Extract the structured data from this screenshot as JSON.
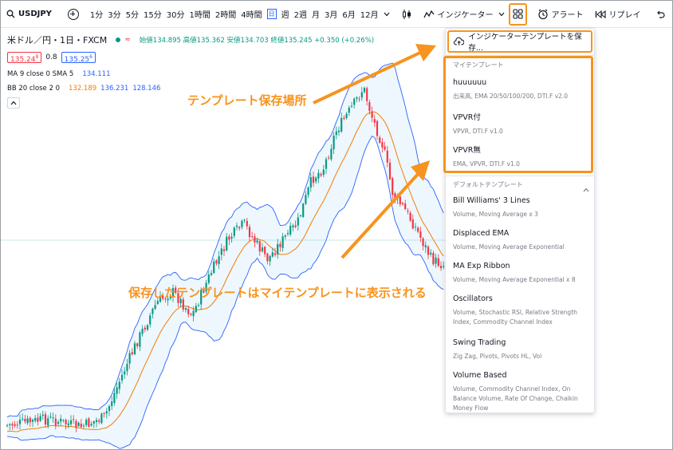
{
  "toolbar": {
    "symbol": "USDJPY",
    "timeframes": [
      "1分",
      "3分",
      "5分",
      "15分",
      "30分",
      "1時間",
      "2時間",
      "4時間",
      "日",
      "週",
      "2週",
      "月",
      "3月",
      "6月",
      "12月"
    ],
    "active_timeframe": "日",
    "indicators_label": "インジケーター",
    "alert_label": "アラート",
    "replay_label": "リプレイ"
  },
  "legend": {
    "title": "米ドル／円・1日・FXCM",
    "ohlc": "始値134.895 高値135.362 安値134.703 終値135.245 +0.350 (+0.26%)",
    "sell": "135.24",
    "sell_sup": "8",
    "spread": "0.8",
    "buy": "135.25",
    "buy_sup": "6",
    "ma_label": "MA 9 close 0 SMA 5",
    "ma_value": "134.111",
    "bb_label": "BB 20 close 2 0",
    "bb_basis": "132.189",
    "bb_upper": "136.231",
    "bb_lower": "128.146"
  },
  "panel": {
    "save_label": "インジケーターテンプレートを保存...",
    "my_section": "マイテンプレート",
    "default_section": "デフォルトテンプレート",
    "my_templates": [
      {
        "name": "huuuuuu",
        "desc": "出来高, EMA 20/50/100/200, DTI.F v2.0"
      },
      {
        "name": "VPVR付",
        "desc": "VPVR, DTI.F v1.0"
      },
      {
        "name": "VPVR無",
        "desc": "EMA, VPVR, DTI.F v1.0"
      }
    ],
    "default_templates": [
      {
        "name": "Bill Williams' 3 Lines",
        "desc": "Volume, Moving Average x 3"
      },
      {
        "name": "Displaced EMA",
        "desc": "Volume, Moving Average Exponential"
      },
      {
        "name": "MA Exp Ribbon",
        "desc": "Volume, Moving Average Exponential x 8"
      },
      {
        "name": "Oscillators",
        "desc": "Volume, Stochastic RSI, Relative Strength Index, Commodity Channel Index"
      },
      {
        "name": "Swing Trading",
        "desc": "Zig Zag, Pivots, Pivots HL, Vol"
      },
      {
        "name": "Volume Based",
        "desc": "Volume, Commodity Channel Index, On Balance Volume, Rate Of Change, Chaikin Money Flow"
      }
    ]
  },
  "annotations": {
    "save_location": "テンプレート保存場所",
    "saved_note": "保存したテンプレートはマイテンプレートに表示される"
  },
  "colors": {
    "accent_orange": "#f7931e",
    "bull": "#089981",
    "bear": "#f23645",
    "band": "#2962ff",
    "ma": "#f57c00"
  }
}
